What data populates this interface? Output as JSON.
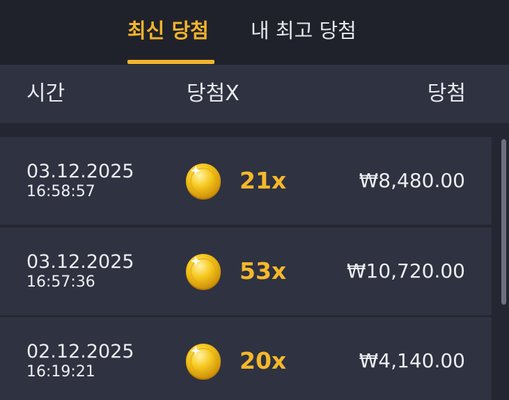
{
  "tabs": {
    "active_label": "최신 당첨",
    "inactive_label": "내 최고 당첨"
  },
  "header": {
    "time_label": "시간",
    "multiplier_label": "당첨X",
    "win_label": "당첨"
  },
  "rows": [
    {
      "date": "03.12.2025",
      "time": "16:58:57",
      "multiplier": "21x",
      "amount": "₩8,480.00"
    },
    {
      "date": "03.12.2025",
      "time": "16:57:36",
      "multiplier": "53x",
      "amount": "₩10,720.00"
    },
    {
      "date": "02.12.2025",
      "time": "16:19:21",
      "multiplier": "20x",
      "amount": "₩4,140.00"
    }
  ],
  "icons": {
    "coin": "gold-coin-icon"
  },
  "colors": {
    "accent": "#f3b52d",
    "background": "#242632",
    "row": "#2f3240",
    "text": "#eceef2"
  }
}
